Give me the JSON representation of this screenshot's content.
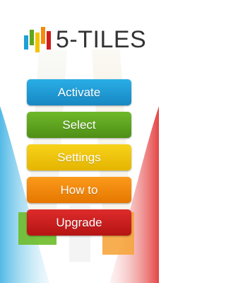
{
  "app": {
    "title": "5-TILES"
  },
  "menu": {
    "buttons": [
      {
        "label": "Activate",
        "color": "#1e9fd8"
      },
      {
        "label": "Select",
        "color": "#5fa51e"
      },
      {
        "label": "Settings",
        "color": "#f2c400"
      },
      {
        "label": "How to",
        "color": "#f58a0b"
      },
      {
        "label": "Upgrade",
        "color": "#cf1c1c"
      }
    ]
  },
  "colors": {
    "text": "#333333",
    "blue": "#1e9fd8",
    "green": "#5fa51e",
    "yellow": "#f2c400",
    "orange": "#f58a0b",
    "red": "#cf1c1c"
  }
}
